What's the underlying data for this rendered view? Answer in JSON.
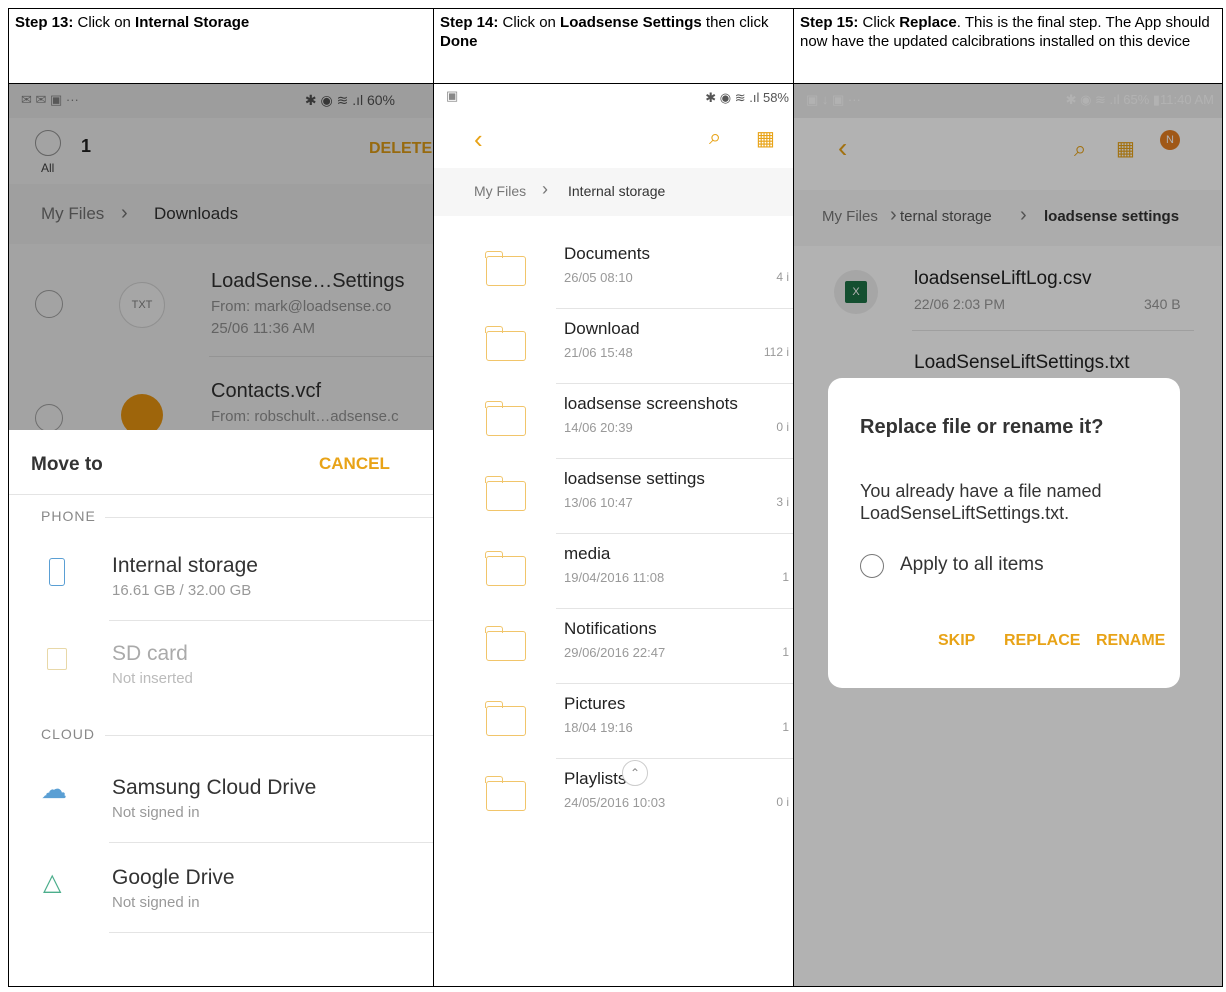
{
  "steps": [
    {
      "prefix": "Step 13:",
      "text1": " Click on ",
      "bold1": "Internal Storage",
      "text2": "",
      "bold2": "",
      "text3": ""
    },
    {
      "prefix": "Step 14:",
      "text1": " Click on ",
      "bold1": "Loadsense Settings",
      "text2": " then click ",
      "bold2": "Done",
      "text3": ""
    },
    {
      "prefix": "Step 15:",
      "text1": " Click ",
      "bold1": "Replace",
      "text2": ". This is the final step. The App should now have the updated calcibrations installed on this device",
      "bold2": "",
      "text3": ""
    }
  ],
  "s1": {
    "battery": "60%",
    "selected_count": "1",
    "all_label": "All",
    "delete_label": "DELETE",
    "breadcrumb_root": "My Files",
    "breadcrumb_current": "Downloads",
    "files": [
      {
        "name": "LoadSense…Settings",
        "from": "From: mark@loadsense.co",
        "date": "25/06 11:36 AM",
        "type": "TXT"
      },
      {
        "name": "Contacts.vcf",
        "from": "From: robschult…adsense.c"
      }
    ],
    "sheet_title": "Move to",
    "cancel_label": "CANCEL",
    "phone_section": "PHONE",
    "cloud_section": "CLOUD",
    "locations": [
      {
        "name": "Internal storage",
        "sub": "16.61 GB / 32.00 GB"
      },
      {
        "name": "SD card",
        "sub": "Not inserted"
      },
      {
        "name": "Samsung Cloud Drive",
        "sub": "Not signed in"
      },
      {
        "name": "Google Drive",
        "sub": "Not signed in"
      }
    ]
  },
  "s2": {
    "battery": "58%",
    "breadcrumb_root": "My Files",
    "breadcrumb_current": "Internal storage",
    "folders": [
      {
        "name": "Documents",
        "date": "26/05 08:10",
        "count": "4 i"
      },
      {
        "name": "Download",
        "date": "21/06 15:48",
        "count": "112 i"
      },
      {
        "name": "loadsense screenshots",
        "date": "14/06 20:39",
        "count": "0 i"
      },
      {
        "name": "loadsense settings",
        "date": "13/06 10:47",
        "count": "3 i"
      },
      {
        "name": "media",
        "date": "19/04/2016 11:08",
        "count": "1"
      },
      {
        "name": "Notifications",
        "date": "29/06/2016 22:47",
        "count": "1"
      },
      {
        "name": "Pictures",
        "date": "18/04 19:16",
        "count": "1"
      },
      {
        "name": "Playlists",
        "date": "24/05/2016 10:03",
        "count": "0 i"
      }
    ]
  },
  "s3": {
    "status_right": "65% ▮11:40 AM",
    "avatar_letter": "N",
    "breadcrumb_root": "My Files",
    "breadcrumb_mid": "ternal storage",
    "breadcrumb_current": "loadsense settings",
    "file1_name": "loadsenseLiftLog.csv",
    "file1_date": "22/06 2:03 PM",
    "file1_size": "340 B",
    "file2_name": "LoadSenseLiftSettings.txt",
    "dialog_title": "Replace file or rename it?",
    "dialog_body": "You already have a file named LoadSenseLiftSettings.txt.",
    "apply_all": "Apply to all items",
    "skip": "SKIP",
    "replace": "REPLACE",
    "rename": "RENAME"
  }
}
